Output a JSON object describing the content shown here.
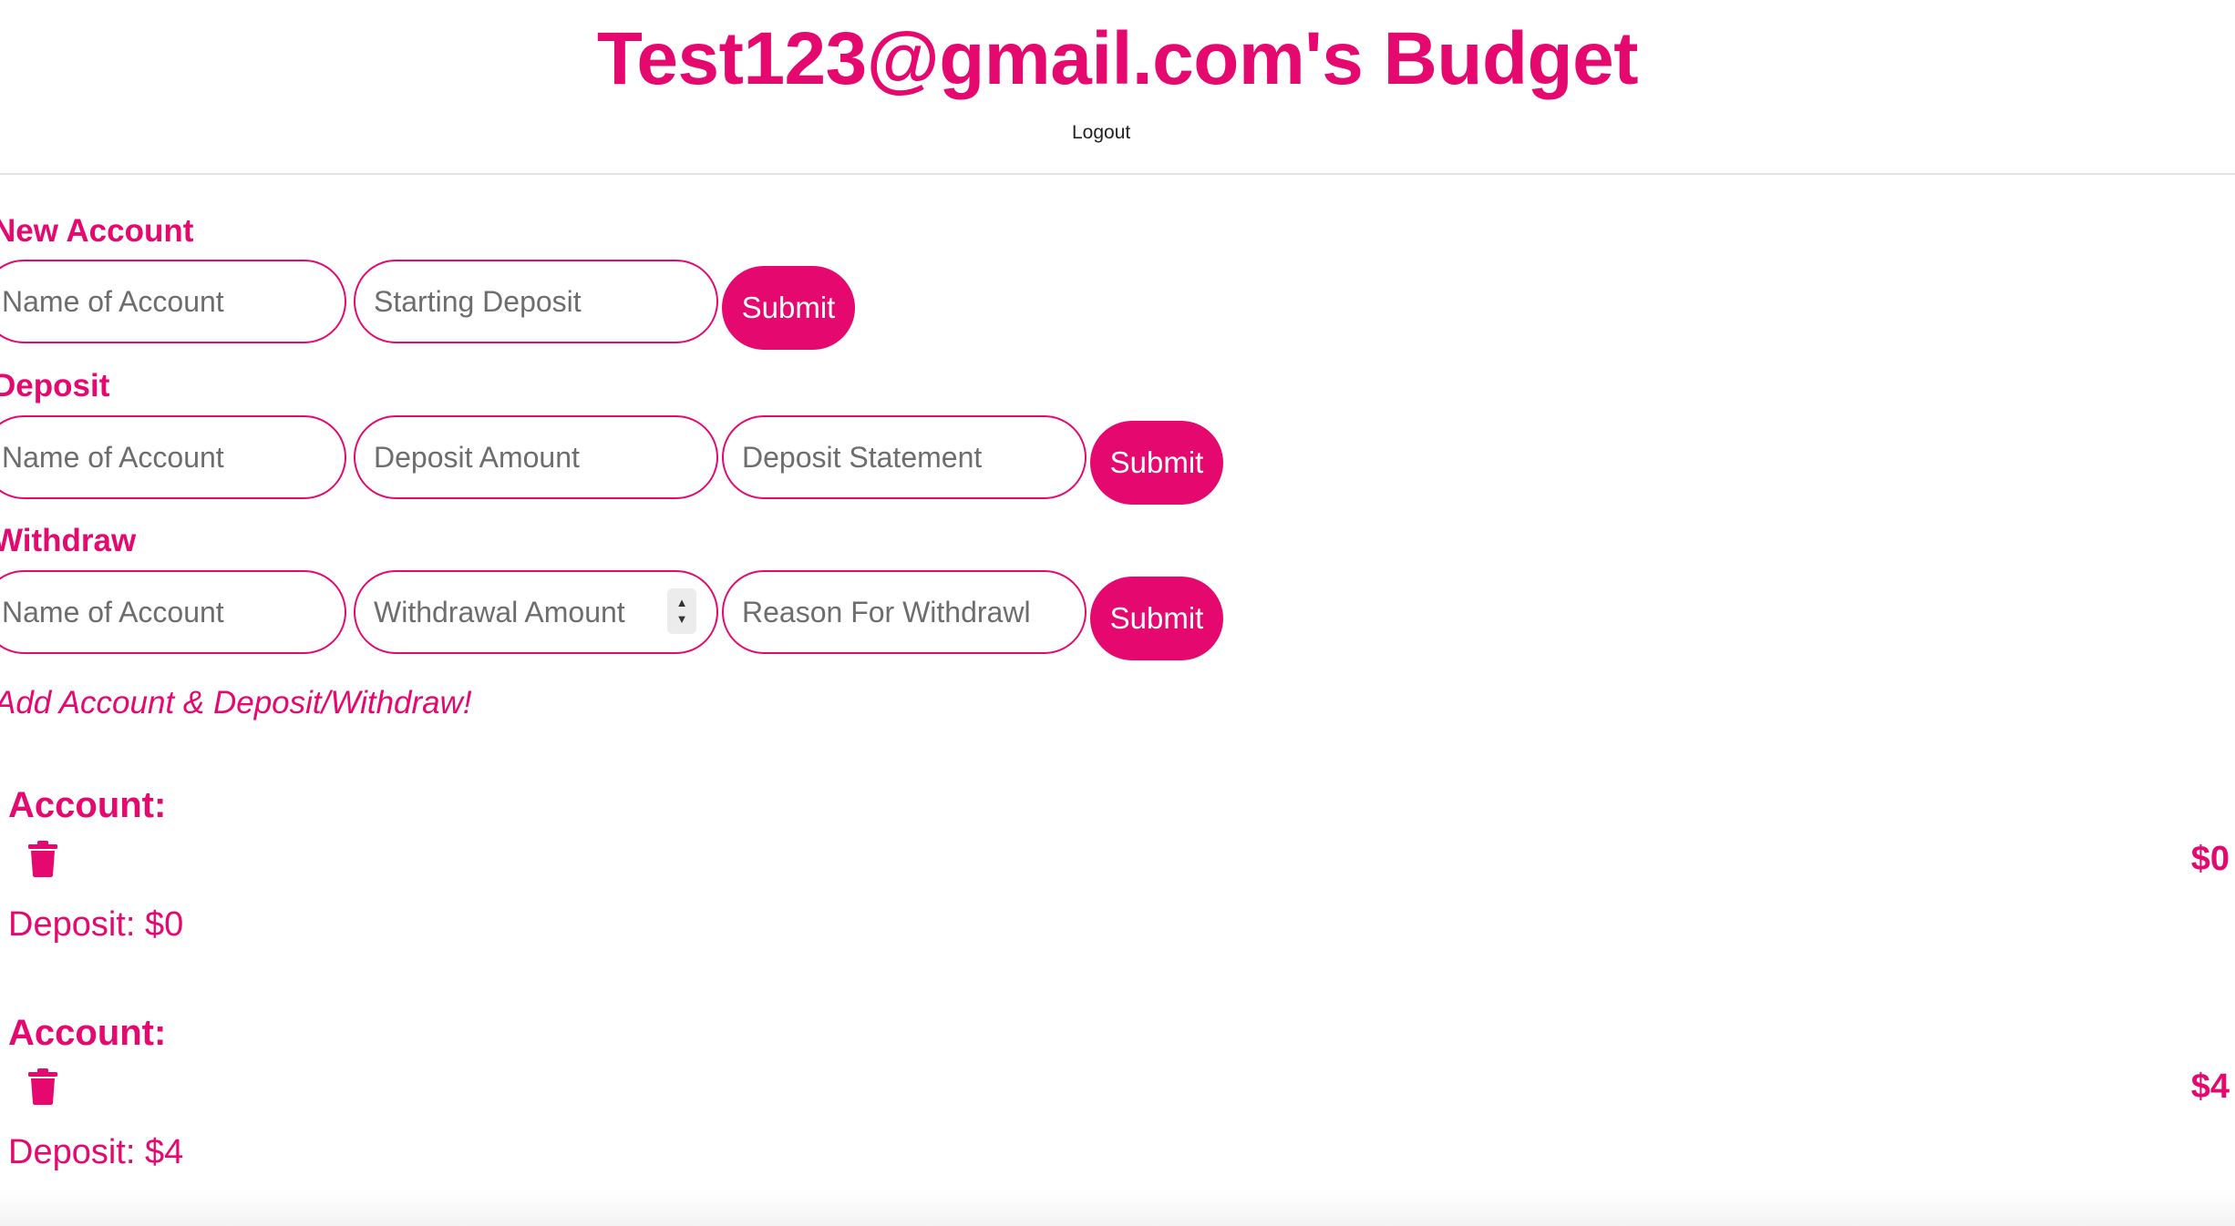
{
  "header": {
    "title": "Test123@gmail.com's Budget",
    "logout_label": "Logout"
  },
  "new_account": {
    "label": "New Account",
    "name_placeholder": "Name of Account",
    "deposit_placeholder": "Starting Deposit",
    "submit_label": "Submit"
  },
  "deposit": {
    "label": "Deposit",
    "name_placeholder": "Name of Account",
    "amount_placeholder": "Deposit Amount",
    "statement_placeholder": "Deposit Statement",
    "submit_label": "Submit"
  },
  "withdraw": {
    "label": "Withdraw",
    "name_placeholder": "Name of Account",
    "amount_placeholder": "Withdrawal Amount",
    "reason_placeholder": "Reason For Withdrawl",
    "submit_label": "Submit"
  },
  "prompt": "Add Account & Deposit/Withdraw!",
  "accounts": [
    {
      "label": "Account:",
      "balance": "$0",
      "deposit_text": "Deposit: $0"
    },
    {
      "label": "Account:",
      "balance": "$4",
      "deposit_text": "Deposit: $4"
    }
  ],
  "colors": {
    "accent": "#e5086f",
    "divider": "#e3e3e3"
  },
  "icons": {
    "delete": "trash-icon",
    "spinner": "number-spinner-icon"
  }
}
